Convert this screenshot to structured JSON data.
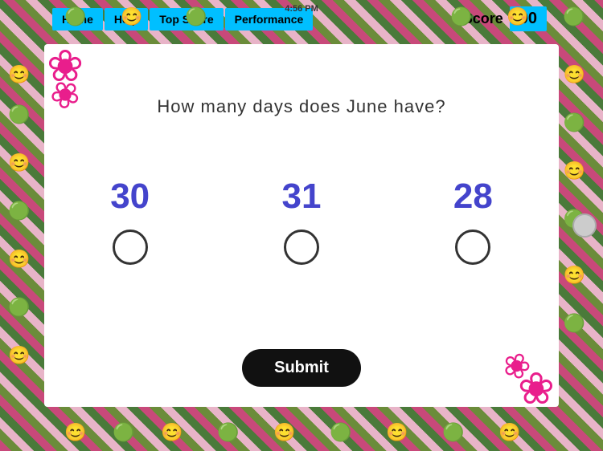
{
  "status_bar": {
    "time": "4:56 PM"
  },
  "nav": {
    "home_label": "Home",
    "help_label": "Help",
    "top_score_label": "Top Score",
    "performance_label": "Performance"
  },
  "score": {
    "label": "Score",
    "value": "00"
  },
  "question": {
    "text": "How many days does June have?"
  },
  "answers": [
    {
      "number": "30",
      "id": "ans-30"
    },
    {
      "number": "31",
      "id": "ans-31"
    },
    {
      "number": "28",
      "id": "ans-28"
    }
  ],
  "submit": {
    "label": "Submit"
  },
  "smileys": {
    "positions": "decorative smiley faces around border"
  }
}
